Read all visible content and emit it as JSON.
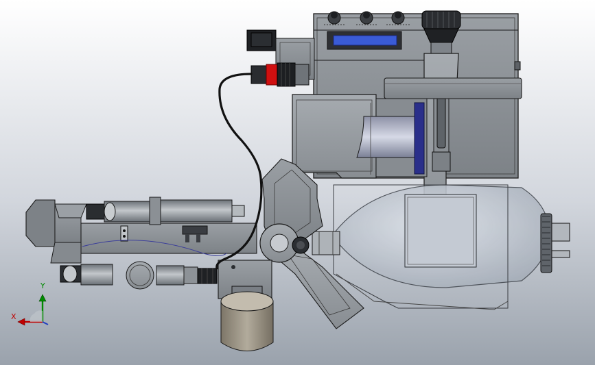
{
  "viewport": {
    "background_top": "#ffffff",
    "background_bottom": "#9aa2ac"
  },
  "model": {
    "part_color": "#8f9499",
    "edge_color": "#1a1a1a",
    "lcd_color": "#3a5bd6",
    "connector_red": "#d01010",
    "cylinder_blue": "#2a2f8a",
    "weight_color": "#9d9586",
    "bulb_fill": "#c9d0da"
  },
  "triad": {
    "x_label": "X",
    "y_label": "Y",
    "x_color": "#c00000",
    "y_color": "#008a00",
    "z_color": "#1f3fbf"
  }
}
